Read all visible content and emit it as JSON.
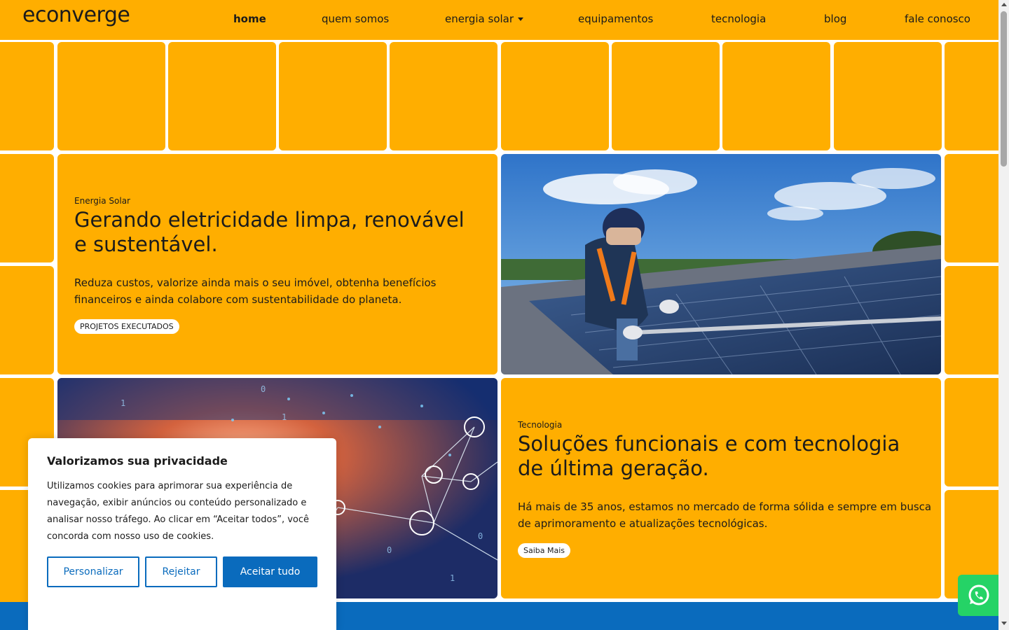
{
  "brand": {
    "logo_text": "econverge",
    "accent": "#ffae00",
    "blue": "#0a6bbd",
    "whatsapp_green": "#25d366"
  },
  "nav": {
    "items": [
      {
        "label": "home",
        "active": true
      },
      {
        "label": "quem somos"
      },
      {
        "label": "energia solar",
        "has_dropdown": true
      },
      {
        "label": "equipamentos"
      },
      {
        "label": "tecnologia"
      },
      {
        "label": "blog"
      },
      {
        "label": "fale conosco"
      }
    ]
  },
  "hero": {
    "solar": {
      "eyebrow": "Energia Solar",
      "title_line1": "Gerando eletricidade limpa, renovável",
      "title_line2": "e sustentável.",
      "text_line1": "Reduza custos, valorize ainda mais o seu imóvel, obtenha benefícios",
      "text_line2": "financeiros e ainda colabore com sustentabilidade do planeta.",
      "button": "PROJETOS EXECUTADOS"
    },
    "tech": {
      "eyebrow": "Tecnologia",
      "title_line1": "Soluções funcionais e com tecnologia",
      "title_line2": "de última geração.",
      "text_line1": "Há mais de 35 anos, estamos no mercado de forma sólida e sempre em busca",
      "text_line2": "de aprimoramento e atualizações tecnológicas.",
      "button": "Saiba Mais"
    }
  },
  "cookie": {
    "title": "Valorizamos sua privacidade",
    "text": "Utilizamos cookies para aprimorar sua experiência de navegação, exibir anúncios ou conteúdo personalizado e analisar nosso tráfego. Ao clicar em “Aceitar todos”, você concorda com nosso uso de cookies.",
    "customize": "Personalizar",
    "reject": "Rejeitar",
    "accept": "Aceitar tudo"
  },
  "icons": {
    "whatsapp": "whatsapp-icon",
    "dropdown": "chevron-down-icon"
  }
}
